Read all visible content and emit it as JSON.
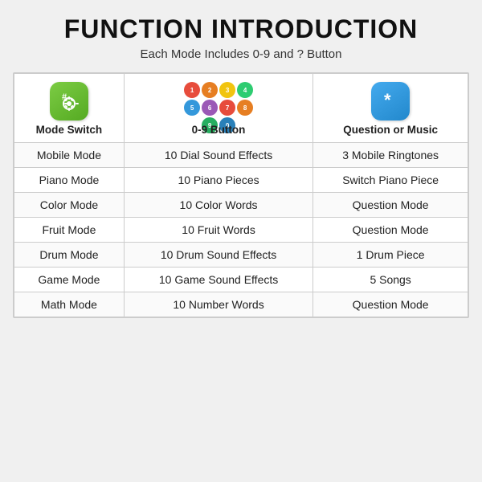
{
  "page": {
    "title": "FUNCTION INTRODUCTION",
    "subtitle": "Each Mode Includes 0-9 and ? Button"
  },
  "headers": {
    "col1": "Mode Switch",
    "col2": "0-9 Button",
    "col3": "Question or Music"
  },
  "rows": [
    {
      "mode": "Mobile Mode",
      "button": "10 Dial Sound Effects",
      "extra": "3 Mobile Ringtones"
    },
    {
      "mode": "Piano Mode",
      "button": "10 Piano Pieces",
      "extra": "Switch Piano Piece"
    },
    {
      "mode": "Color Mode",
      "button": "10 Color Words",
      "extra": "Question Mode"
    },
    {
      "mode": "Fruit Mode",
      "button": "10 Fruit Words",
      "extra": "Question Mode"
    },
    {
      "mode": "Drum Mode",
      "button": "10 Drum Sound Effects",
      "extra": "1 Drum Piece"
    },
    {
      "mode": "Game Mode",
      "button": "10 Game Sound Effects",
      "extra": "5 Songs"
    },
    {
      "mode": "Math Mode",
      "button": "10 Number Words",
      "extra": "Question Mode"
    }
  ],
  "numCircles": [
    {
      "bg": "#e74c3c",
      "label": "1"
    },
    {
      "bg": "#e67e22",
      "label": "2"
    },
    {
      "bg": "#f1c40f",
      "label": "3"
    },
    {
      "bg": "#2ecc71",
      "label": "4"
    },
    {
      "bg": "#3498db",
      "label": "5"
    },
    {
      "bg": "#9b59b6",
      "label": "6"
    },
    {
      "bg": "#e74c3c",
      "label": "7"
    },
    {
      "bg": "#e67e22",
      "label": "8"
    },
    {
      "bg": "#27ae60",
      "label": "9"
    },
    {
      "bg": "#2980b9",
      "label": "0"
    }
  ]
}
